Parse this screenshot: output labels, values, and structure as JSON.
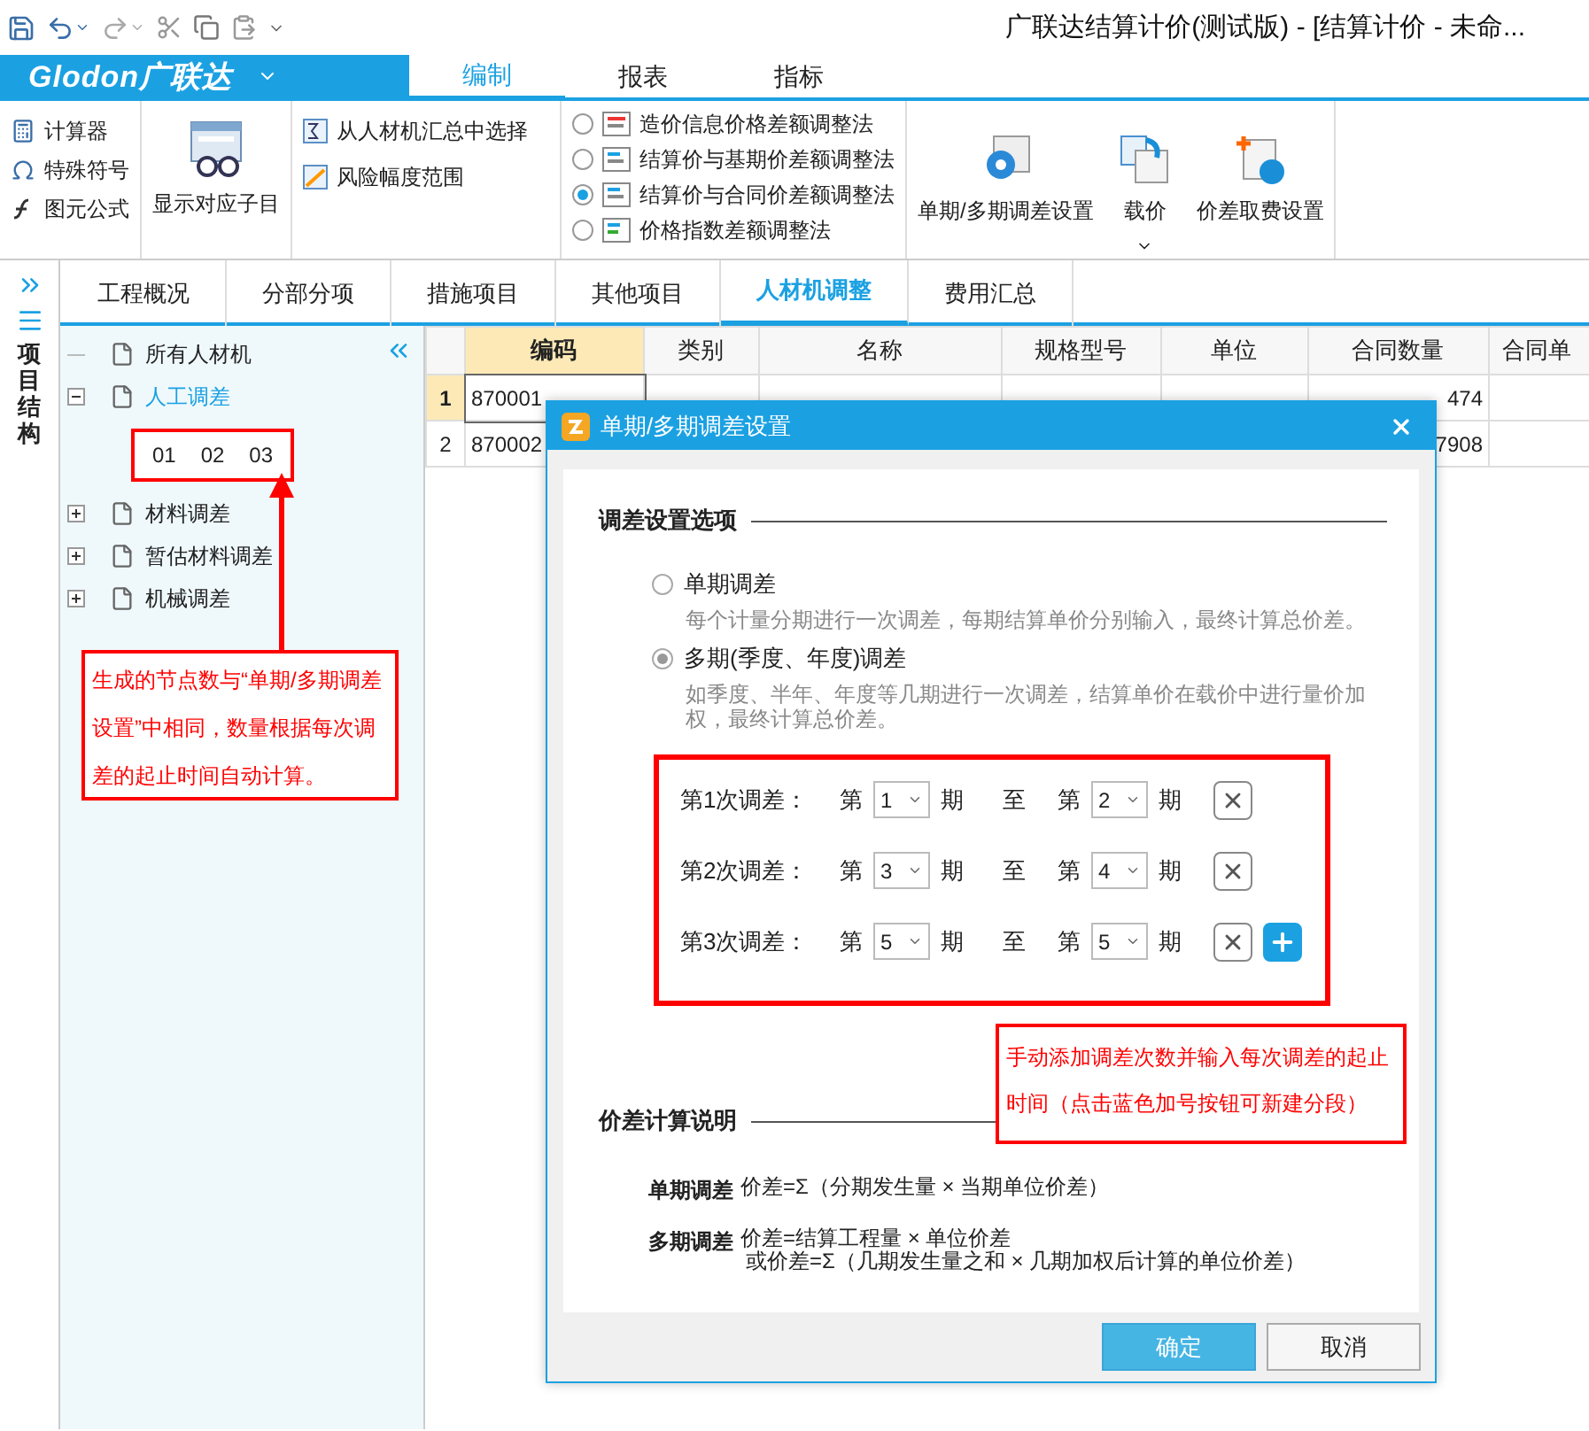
{
  "window": {
    "title": "广联达结算计价(测试版) - [结算计价 - 未命..."
  },
  "app_menu": {
    "logo": "Glodon广联达"
  },
  "ribbon_tabs": [
    {
      "label": "编制",
      "selected": true
    },
    {
      "label": "报表",
      "selected": false
    },
    {
      "label": "指标",
      "selected": false
    }
  ],
  "ribbon": {
    "tools": [
      "计算器",
      "特殊符号",
      "图元公式"
    ],
    "show_items": "显示对应子目",
    "select_actions": [
      "从人材机汇总中选择",
      "风险幅度范围"
    ],
    "methods": [
      {
        "label": "造价信息价格差额调整法",
        "selected": false
      },
      {
        "label": "结算价与基期价差额调整法",
        "selected": false
      },
      {
        "label": "结算价与合同价差额调整法",
        "selected": true
      },
      {
        "label": "价格指数差额调整法",
        "selected": false
      }
    ],
    "settings": [
      {
        "label": "单期/多期调差设置",
        "dropdown": false
      },
      {
        "label": "载价",
        "dropdown": true
      },
      {
        "label": "价差取费设置",
        "dropdown": false
      }
    ]
  },
  "side_strip": {
    "title": "项目结构"
  },
  "sheet_tabs": [
    {
      "label": "工程概况",
      "selected": false
    },
    {
      "label": "分部分项",
      "selected": false
    },
    {
      "label": "措施项目",
      "selected": false
    },
    {
      "label": "其他项目",
      "selected": false
    },
    {
      "label": "人材机调整",
      "selected": true
    },
    {
      "label": "费用汇总",
      "selected": false
    }
  ],
  "tree": {
    "items": [
      {
        "label": "所有人材机",
        "selected": false
      },
      {
        "label": "人工调差",
        "selected": true,
        "expanded": true,
        "periods": [
          "01",
          "02",
          "03"
        ]
      },
      {
        "label": "材料调差",
        "selected": false,
        "expanded": false
      },
      {
        "label": "暂估材料调差",
        "selected": false,
        "expanded": false
      },
      {
        "label": "机械调差",
        "selected": false,
        "expanded": false
      }
    ]
  },
  "grid": {
    "columns": [
      {
        "label": "编码",
        "selected": true
      },
      {
        "label": "类别",
        "selected": false
      },
      {
        "label": "名称",
        "selected": false
      },
      {
        "label": "规格型号",
        "selected": false
      },
      {
        "label": "单位",
        "selected": false
      },
      {
        "label": "合同数量",
        "selected": false
      },
      {
        "label": "合同单",
        "selected": false
      }
    ],
    "rows": [
      {
        "number": "1",
        "selected": true,
        "code": "870001",
        "contract_qty": "474"
      },
      {
        "number": "2",
        "selected": false,
        "code": "870002",
        "contract_qty": "7908"
      }
    ]
  },
  "dialog": {
    "title": "单期/多期调差设置",
    "options_section": "调差设置选项",
    "modes": [
      {
        "label": "单期调差",
        "selected": false,
        "description": "每个计量分期进行一次调差，每期结算单价分别输入，最终计算总价差。"
      },
      {
        "label": "多期(季度、年度)调差",
        "selected": true,
        "description": "如季度、半年、年度等几期进行一次调差，结算单价在载价中进行量价加权，最终计算总价差。"
      }
    ],
    "adjustments": [
      {
        "label": "第1次调差：",
        "from_prefix": "第",
        "from": "1",
        "from_suffix": "期",
        "to_word": "至",
        "to_prefix": "第",
        "to": "2",
        "to_suffix": "期",
        "addable": false
      },
      {
        "label": "第2次调差：",
        "from_prefix": "第",
        "from": "3",
        "from_suffix": "期",
        "to_word": "至",
        "to_prefix": "第",
        "to": "4",
        "to_suffix": "期",
        "addable": false
      },
      {
        "label": "第3次调差：",
        "from_prefix": "第",
        "from": "5",
        "from_suffix": "期",
        "to_word": "至",
        "to_prefix": "第",
        "to": "5",
        "to_suffix": "期",
        "addable": true
      }
    ],
    "formula_section": "价差计算说明",
    "formulas": [
      {
        "term": "单期调差",
        "lines": [
          "价差=Σ（分期发生量 × 当期单位价差）"
        ]
      },
      {
        "term": "多期调差",
        "lines": [
          "价差=结算工程量 × 单位价差",
          "或价差=Σ（几期发生量之和 × 几期加权后计算的单位价差）"
        ]
      }
    ],
    "buttons": [
      {
        "label": "确定",
        "primary": true
      },
      {
        "label": "取消",
        "primary": false
      }
    ]
  },
  "annotations": [
    {
      "text": "生成的节点数与“单期/多期调差设置”中相同，数量根据每次调差的起止时间自动计算。"
    },
    {
      "text": "手动添加调差次数并输入每次调差的起止时间（点击蓝色加号按钮可新建分段）"
    }
  ]
}
